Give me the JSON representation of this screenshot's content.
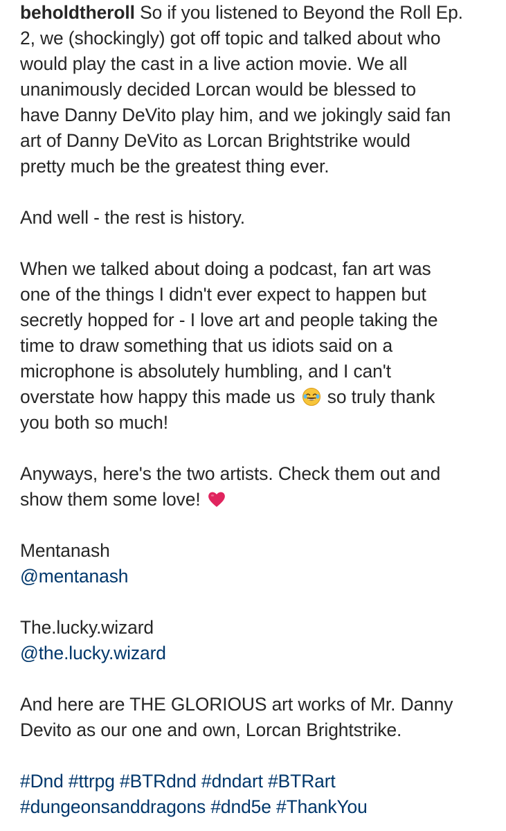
{
  "post": {
    "username": "beholdtheroll",
    "p1": [
      " So if you listened to Beyond the Roll Ep.",
      "2, we (shockingly) got off topic and talked about who",
      "would play the cast in a live action movie. We all",
      "unanimously decided Lorcan would be blessed to",
      "have Danny DeVito play him, and we jokingly said fan",
      "art of Danny DeVito as Lorcan Brightstrike would",
      "pretty much be the greatest thing ever."
    ],
    "p2": "And well - the rest is history.",
    "p3": [
      "When we talked about doing a podcast, fan art was",
      "one of the things I didn't ever expect to happen but",
      "secretly hopped for - I love art and people taking the",
      "time to draw something that us idiots said on a",
      "microphone is absolutely humbling, and I can't",
      "overstate how happy this made us",
      "so truly thank",
      "you both so much!"
    ],
    "p4": [
      "Anyways, here's the two artists. Check them out and",
      "show them some love!"
    ],
    "artist1": {
      "name": "Mentanash",
      "handle": "@mentanash"
    },
    "artist2": {
      "name": "The.lucky.wizard",
      "handle": "@the.lucky.wizard"
    },
    "p5": [
      "And here are THE GLORIOUS art works of Mr. Danny",
      "Devito as our one and own, Lorcan Brightstrike."
    ],
    "hashtags_line1": "#Dnd #ttrpg #BTRdnd #dndart #BTRart",
    "hashtags_line2": "#dungeonsanddragons #dnd5e #ThankYou",
    "emoji1": "laughing-tears-emoji",
    "emoji2": "red-heart-emoji",
    "colors": {
      "text": "#262626",
      "link": "#00376b",
      "heart": "#e0245e"
    }
  }
}
